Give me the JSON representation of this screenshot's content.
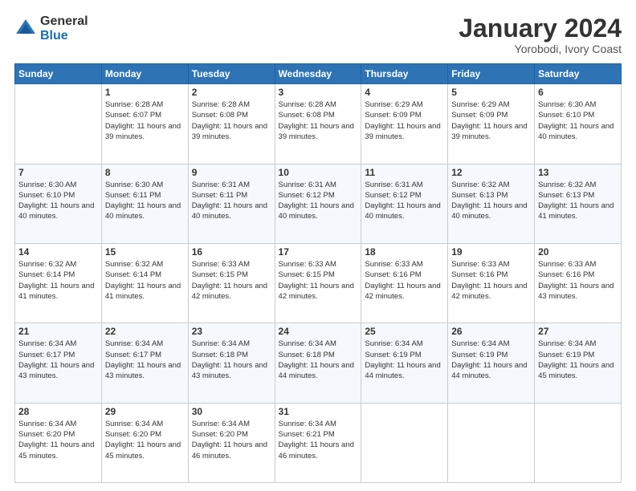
{
  "logo": {
    "general": "General",
    "blue": "Blue"
  },
  "header": {
    "month_title": "January 2024",
    "location": "Yorobodi, Ivory Coast"
  },
  "weekdays": [
    "Sunday",
    "Monday",
    "Tuesday",
    "Wednesday",
    "Thursday",
    "Friday",
    "Saturday"
  ],
  "weeks": [
    [
      {
        "day": "",
        "sunrise": "",
        "sunset": "",
        "daylight": ""
      },
      {
        "day": "1",
        "sunrise": "Sunrise: 6:28 AM",
        "sunset": "Sunset: 6:07 PM",
        "daylight": "Daylight: 11 hours and 39 minutes."
      },
      {
        "day": "2",
        "sunrise": "Sunrise: 6:28 AM",
        "sunset": "Sunset: 6:08 PM",
        "daylight": "Daylight: 11 hours and 39 minutes."
      },
      {
        "day": "3",
        "sunrise": "Sunrise: 6:28 AM",
        "sunset": "Sunset: 6:08 PM",
        "daylight": "Daylight: 11 hours and 39 minutes."
      },
      {
        "day": "4",
        "sunrise": "Sunrise: 6:29 AM",
        "sunset": "Sunset: 6:09 PM",
        "daylight": "Daylight: 11 hours and 39 minutes."
      },
      {
        "day": "5",
        "sunrise": "Sunrise: 6:29 AM",
        "sunset": "Sunset: 6:09 PM",
        "daylight": "Daylight: 11 hours and 39 minutes."
      },
      {
        "day": "6",
        "sunrise": "Sunrise: 6:30 AM",
        "sunset": "Sunset: 6:10 PM",
        "daylight": "Daylight: 11 hours and 40 minutes."
      }
    ],
    [
      {
        "day": "7",
        "sunrise": "Sunrise: 6:30 AM",
        "sunset": "Sunset: 6:10 PM",
        "daylight": "Daylight: 11 hours and 40 minutes."
      },
      {
        "day": "8",
        "sunrise": "Sunrise: 6:30 AM",
        "sunset": "Sunset: 6:11 PM",
        "daylight": "Daylight: 11 hours and 40 minutes."
      },
      {
        "day": "9",
        "sunrise": "Sunrise: 6:31 AM",
        "sunset": "Sunset: 6:11 PM",
        "daylight": "Daylight: 11 hours and 40 minutes."
      },
      {
        "day": "10",
        "sunrise": "Sunrise: 6:31 AM",
        "sunset": "Sunset: 6:12 PM",
        "daylight": "Daylight: 11 hours and 40 minutes."
      },
      {
        "day": "11",
        "sunrise": "Sunrise: 6:31 AM",
        "sunset": "Sunset: 6:12 PM",
        "daylight": "Daylight: 11 hours and 40 minutes."
      },
      {
        "day": "12",
        "sunrise": "Sunrise: 6:32 AM",
        "sunset": "Sunset: 6:13 PM",
        "daylight": "Daylight: 11 hours and 40 minutes."
      },
      {
        "day": "13",
        "sunrise": "Sunrise: 6:32 AM",
        "sunset": "Sunset: 6:13 PM",
        "daylight": "Daylight: 11 hours and 41 minutes."
      }
    ],
    [
      {
        "day": "14",
        "sunrise": "Sunrise: 6:32 AM",
        "sunset": "Sunset: 6:14 PM",
        "daylight": "Daylight: 11 hours and 41 minutes."
      },
      {
        "day": "15",
        "sunrise": "Sunrise: 6:32 AM",
        "sunset": "Sunset: 6:14 PM",
        "daylight": "Daylight: 11 hours and 41 minutes."
      },
      {
        "day": "16",
        "sunrise": "Sunrise: 6:33 AM",
        "sunset": "Sunset: 6:15 PM",
        "daylight": "Daylight: 11 hours and 42 minutes."
      },
      {
        "day": "17",
        "sunrise": "Sunrise: 6:33 AM",
        "sunset": "Sunset: 6:15 PM",
        "daylight": "Daylight: 11 hours and 42 minutes."
      },
      {
        "day": "18",
        "sunrise": "Sunrise: 6:33 AM",
        "sunset": "Sunset: 6:16 PM",
        "daylight": "Daylight: 11 hours and 42 minutes."
      },
      {
        "day": "19",
        "sunrise": "Sunrise: 6:33 AM",
        "sunset": "Sunset: 6:16 PM",
        "daylight": "Daylight: 11 hours and 42 minutes."
      },
      {
        "day": "20",
        "sunrise": "Sunrise: 6:33 AM",
        "sunset": "Sunset: 6:16 PM",
        "daylight": "Daylight: 11 hours and 43 minutes."
      }
    ],
    [
      {
        "day": "21",
        "sunrise": "Sunrise: 6:34 AM",
        "sunset": "Sunset: 6:17 PM",
        "daylight": "Daylight: 11 hours and 43 minutes."
      },
      {
        "day": "22",
        "sunrise": "Sunrise: 6:34 AM",
        "sunset": "Sunset: 6:17 PM",
        "daylight": "Daylight: 11 hours and 43 minutes."
      },
      {
        "day": "23",
        "sunrise": "Sunrise: 6:34 AM",
        "sunset": "Sunset: 6:18 PM",
        "daylight": "Daylight: 11 hours and 43 minutes."
      },
      {
        "day": "24",
        "sunrise": "Sunrise: 6:34 AM",
        "sunset": "Sunset: 6:18 PM",
        "daylight": "Daylight: 11 hours and 44 minutes."
      },
      {
        "day": "25",
        "sunrise": "Sunrise: 6:34 AM",
        "sunset": "Sunset: 6:19 PM",
        "daylight": "Daylight: 11 hours and 44 minutes."
      },
      {
        "day": "26",
        "sunrise": "Sunrise: 6:34 AM",
        "sunset": "Sunset: 6:19 PM",
        "daylight": "Daylight: 11 hours and 44 minutes."
      },
      {
        "day": "27",
        "sunrise": "Sunrise: 6:34 AM",
        "sunset": "Sunset: 6:19 PM",
        "daylight": "Daylight: 11 hours and 45 minutes."
      }
    ],
    [
      {
        "day": "28",
        "sunrise": "Sunrise: 6:34 AM",
        "sunset": "Sunset: 6:20 PM",
        "daylight": "Daylight: 11 hours and 45 minutes."
      },
      {
        "day": "29",
        "sunrise": "Sunrise: 6:34 AM",
        "sunset": "Sunset: 6:20 PM",
        "daylight": "Daylight: 11 hours and 45 minutes."
      },
      {
        "day": "30",
        "sunrise": "Sunrise: 6:34 AM",
        "sunset": "Sunset: 6:20 PM",
        "daylight": "Daylight: 11 hours and 46 minutes."
      },
      {
        "day": "31",
        "sunrise": "Sunrise: 6:34 AM",
        "sunset": "Sunset: 6:21 PM",
        "daylight": "Daylight: 11 hours and 46 minutes."
      },
      {
        "day": "",
        "sunrise": "",
        "sunset": "",
        "daylight": ""
      },
      {
        "day": "",
        "sunrise": "",
        "sunset": "",
        "daylight": ""
      },
      {
        "day": "",
        "sunrise": "",
        "sunset": "",
        "daylight": ""
      }
    ]
  ]
}
